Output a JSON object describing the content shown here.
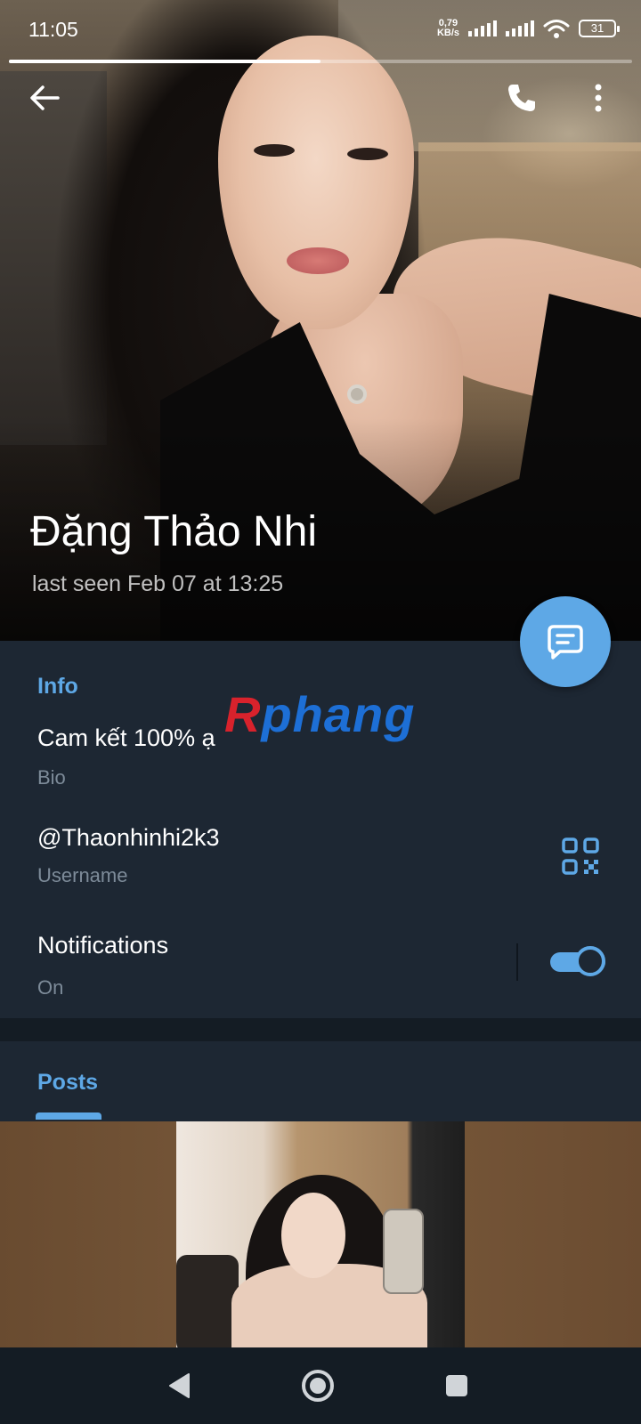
{
  "status_bar": {
    "time": "11:05",
    "net_speed_value": "0,79",
    "net_speed_unit": "KB/s",
    "battery": "31"
  },
  "story_progress": 0.5,
  "profile": {
    "name": "Đặng Thảo Nhi",
    "last_seen": "last seen Feb 07 at 13:25"
  },
  "watermark": {
    "part1": "R",
    "part2": "phang"
  },
  "info": {
    "title": "Info",
    "bio_value": "Cam kết 100% ạ",
    "bio_label": "Bio",
    "username_value": "@Thaonhinhi2k3",
    "username_label": "Username",
    "notifications_label": "Notifications",
    "notifications_state": "On",
    "notifications_on": true
  },
  "posts": {
    "title": "Posts"
  },
  "icons": {
    "back": "arrow-left-icon",
    "call": "phone-icon",
    "more": "more-vertical-icon",
    "message": "message-icon",
    "qr": "qr-code-icon",
    "nav_back": "triangle-back-icon",
    "nav_home": "circle-home-icon",
    "nav_recent": "square-recents-icon"
  },
  "colors": {
    "accent": "#5ea8e6",
    "background": "#17212b",
    "card": "#1d2733",
    "secondary_text": "#7d8b99"
  }
}
